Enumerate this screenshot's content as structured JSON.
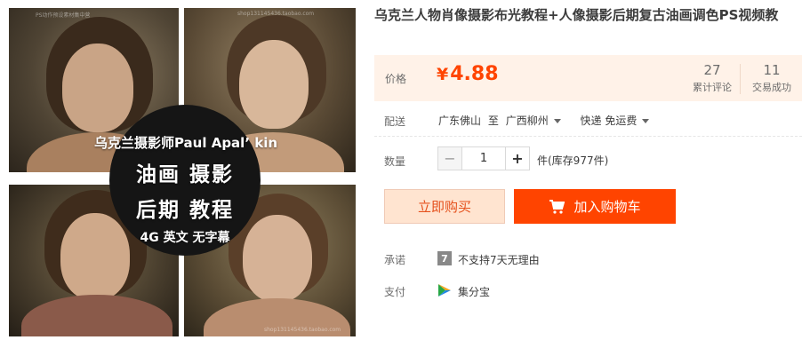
{
  "product": {
    "title": "乌克兰人物肖像摄影布光教程+人像摄影后期复古油画调色PS视频教",
    "image_overlay": {
      "line1": "乌克兰摄影师Paul Apal’ kin",
      "line2": "油画 摄影",
      "line3": "后期 教程",
      "line4": "4G 英文 无字幕"
    },
    "watermarks": [
      "PS动作预设素材集中营",
      "shop131145436.taobao.com"
    ]
  },
  "price": {
    "label": "价格",
    "currency": "¥",
    "value": "4.88"
  },
  "stats": {
    "reviews_count": "27",
    "reviews_label": "累计评论",
    "deals_count": "11",
    "deals_label": "交易成功"
  },
  "shipping": {
    "label": "配送",
    "from": "广东佛山",
    "to_word": "至",
    "to": "广西柳州",
    "method": "快递 免运费"
  },
  "quantity": {
    "label": "数量",
    "minus": "−",
    "value": "1",
    "plus": "+",
    "stock_text": "件(库存977件)"
  },
  "actions": {
    "buy_now": "立即购买",
    "add_to_cart": "加入购物车"
  },
  "promise": {
    "label": "承诺",
    "icon_text": "7",
    "text": "不支持7天无理由"
  },
  "payment": {
    "label": "支付",
    "method": "集分宝"
  },
  "colors": {
    "accent": "#ff4400",
    "price_bg": "#fff2e8",
    "buy_now_bg": "#ffe4d0"
  }
}
